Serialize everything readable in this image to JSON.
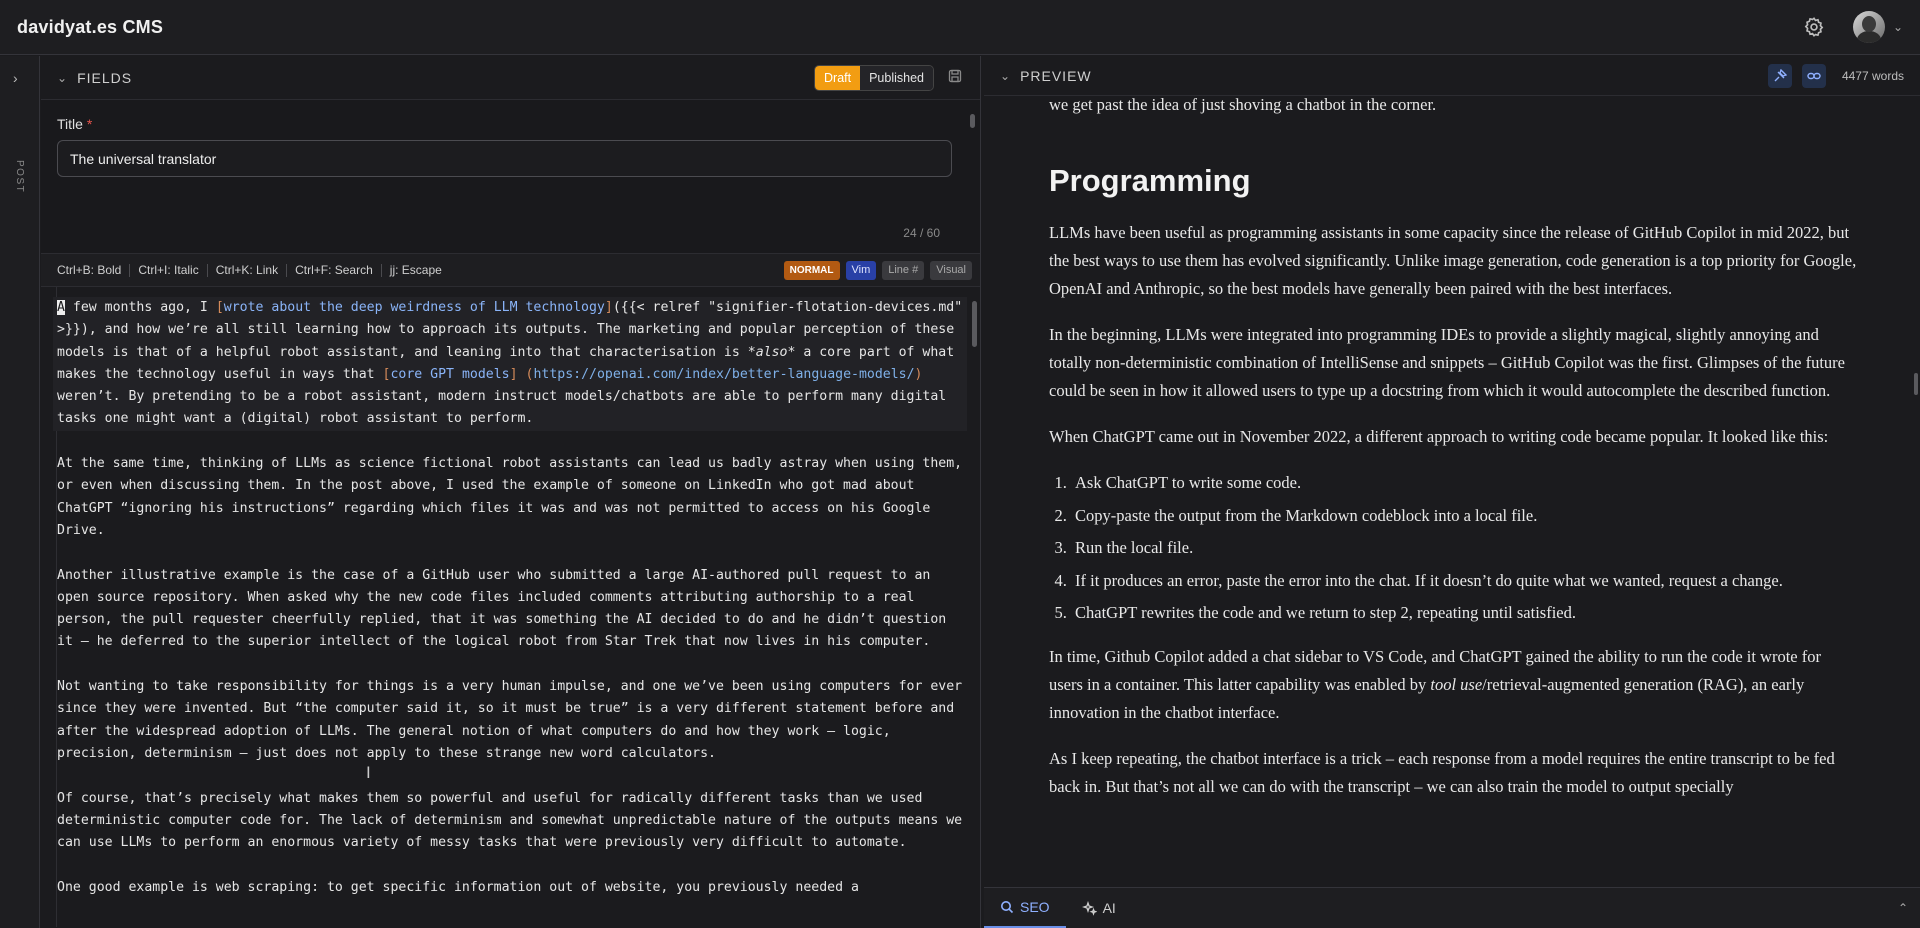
{
  "app": {
    "title": "davidyat.es CMS"
  },
  "rail": {
    "label": "POST"
  },
  "fields": {
    "header": "FIELDS",
    "status": {
      "draft": "Draft",
      "published": "Published"
    },
    "title_label": "Title",
    "required_mark": "*",
    "title_value": "The universal translator",
    "title_count": "24 / 60"
  },
  "toolbar": {
    "hints": [
      "Ctrl+B: Bold",
      "Ctrl+I: Italic",
      "Ctrl+K: Link",
      "Ctrl+F: Search",
      "jj: Escape"
    ],
    "mode": "NORMAL",
    "vim": "Vim",
    "line_numbers": "Line #",
    "visual": "Visual"
  },
  "editor": {
    "p1": {
      "cursor": "A",
      "a": " few months ago, I ",
      "b1": "[",
      "link1": "wrote about the deep weirdness of LLM technology",
      "b2": "]",
      "c": "({{< relref \"signifier-flotation-devices.md\" >}}), and how we’re all still learning how to approach its outputs. The marketing and popular perception of these models is that of a helpful robot assistant, and leaning into that characterisation is ",
      "em": "*also*",
      "d": " a core part of what makes the technology useful in ways that ",
      "b3": "[",
      "link2": "core GPT models",
      "b4": "]",
      "e": " ",
      "p_open": "(",
      "url": "https://openai.com/index/better-language-models/",
      "p_close": ")",
      "f": " weren’t. By pretending to be a robot assistant, modern instruct models/chatbots are able to perform many digital tasks one might want a (digital) robot assistant to perform."
    },
    "p2": "At the same time, thinking of LLMs as science fictional robot assistants can lead us badly astray when using them, or even when discussing them. In the post above, I used the example of someone on LinkedIn who got mad about ChatGPT “ignoring his instructions” regarding which files it was and was not permitted to access on his Google Drive.",
    "p3": "Another illustrative example is the case of a GitHub user who submitted a large AI-authored pull request to an open source repository. When asked why the new code files included comments attributing authorship to a real person, the pull requester cheerfully replied, that it was something the AI decided to do and he didn’t question it – he deferred to the superior intellect of the logical robot from Star Trek that now lives in his computer.",
    "p4": "Not wanting to take responsibility for things is a very human impulse, and one we’ve been using computers for ever since they were invented. But “the computer said it, so it must be true” is a very different statement before and after the widespread adoption of LLMs. The general notion of what computers do and how they work – logic, precision, determinism – just does not apply to these strange new word calculators.",
    "p5": "Of course, that’s precisely what makes them so powerful and useful for radically different tasks than we used deterministic computer code for. The lack of determinism and somewhat unpredictable nature of the outputs means we can use LLMs to perform an enormous variety of messy tasks that were previously very difficult to automate.",
    "p6": "One good example is web scraping: to get specific information out of website, you previously needed a"
  },
  "preview": {
    "header": "PREVIEW",
    "word_count": "4477 words",
    "top_line": "we get past the idea of just shoving a chatbot in the corner.",
    "heading": "Programming",
    "p1": "LLMs have been useful as programming assistants in some capacity since the release of GitHub Copilot in mid 2022, but the best ways to use them has evolved significantly. Unlike image generation, code generation is a top priority for Google, OpenAI and Anthropic, so the best models have generally been paired with the best interfaces.",
    "p2": "In the beginning, LLMs were integrated into programming IDEs to provide a slightly magical, slightly annoying and totally non-deterministic combination of IntelliSense and snippets – GitHub Copilot was the first. Glimpses of the future could be seen in how it allowed users to type up a docstring from which it would autocomplete the described function.",
    "p3": "When ChatGPT came out in November 2022, a different approach to writing code became popular. It looked like this:",
    "list": [
      "Ask ChatGPT to write some code.",
      "Copy-paste the output from the Markdown codeblock into a local file.",
      "Run the local file.",
      "If it produces an error, paste the error into the chat. If it doesn’t do quite what we wanted, request a change.",
      "ChatGPT rewrites the code and we return to step 2, repeating until satisfied."
    ],
    "p4a": "In time, Github Copilot added a chat sidebar to VS Code, and ChatGPT gained the ability to run the code it wrote for users in a container. This latter capability was enabled by ",
    "p4em": "tool use",
    "p4b": "/retrieval-augmented generation (RAG), an early innovation in the chatbot interface.",
    "p5": "As I keep repeating, the chatbot interface is a trick – each response from a model requires the entire transcript to be fed back in. But that’s not all we can do with the transcript – we can also train the model to output specially"
  },
  "bottom_tabs": {
    "seo": "SEO",
    "ai": "AI"
  },
  "colors": {
    "accent": "#f29d12",
    "link": "#8ab4f8",
    "active_tab": "#8fb0ff"
  }
}
